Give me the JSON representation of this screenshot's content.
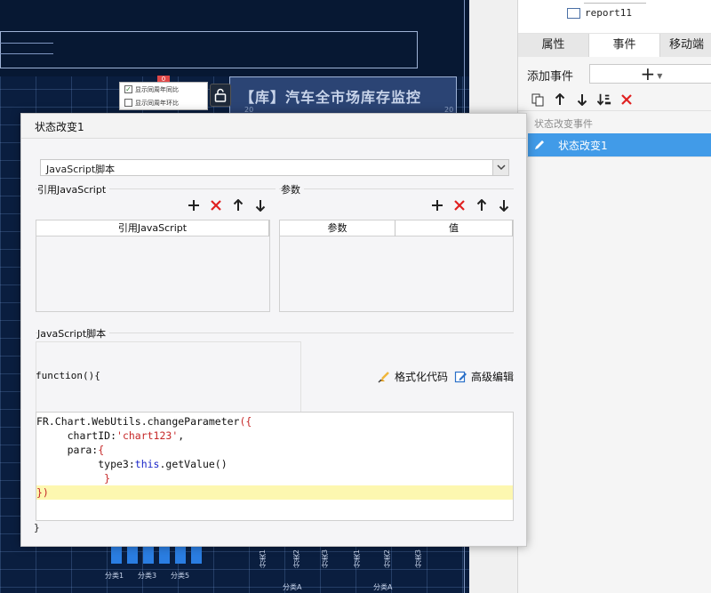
{
  "canvas": {
    "chart_title": "【库】汽车全市场库存监控",
    "widget_marker": "0",
    "checkbox_items": [
      {
        "label": "显示同周年同比",
        "checked": true
      },
      {
        "label": "显示同周年环比",
        "checked": false
      }
    ],
    "hint_a": "20",
    "hint_b": "20",
    "x_categories": [
      "分类1",
      "分类3",
      "分类5"
    ],
    "v_categories": [
      "分类1",
      "分类2",
      "分类3",
      "分类1",
      "分类2",
      "分类3"
    ],
    "group_labels": [
      "分类A",
      "分类A"
    ],
    "colors": {
      "background": "#0a1e3f",
      "bar": "#2a7de1"
    }
  },
  "right_panel": {
    "tree_item": "report11",
    "tabs": [
      "属性",
      "事件",
      "移动端"
    ],
    "active_tab": "事件",
    "add_event_label": "添加事件",
    "add_event_button": "+",
    "toolbar_icons": [
      "copy-icon",
      "arrow-up-icon",
      "arrow-down-icon",
      "move-bottom-icon",
      "delete-icon"
    ],
    "event_group": "状态改变事件",
    "event_item": "状态改变1",
    "colors": {
      "selected": "#419be8"
    }
  },
  "dialog": {
    "title": "状态改变1",
    "type_select": {
      "value": "JavaScript脚本"
    },
    "ref_js": {
      "section": "引用JavaScript",
      "column": "引用JavaScript"
    },
    "params": {
      "section": "参数",
      "columns": [
        "参数",
        "值"
      ]
    },
    "script": {
      "section": "JavaScript脚本",
      "function_open": "function(){",
      "function_close": "}",
      "format_label": "格式化代码",
      "advanced_label": "高级编辑",
      "code_lines": [
        "FR.Chart.WebUtils.changeParameter({",
        "     chartID:'chart123',",
        "     para:{",
        "          type3:this.getValue()",
        "           }",
        "})"
      ]
    }
  }
}
